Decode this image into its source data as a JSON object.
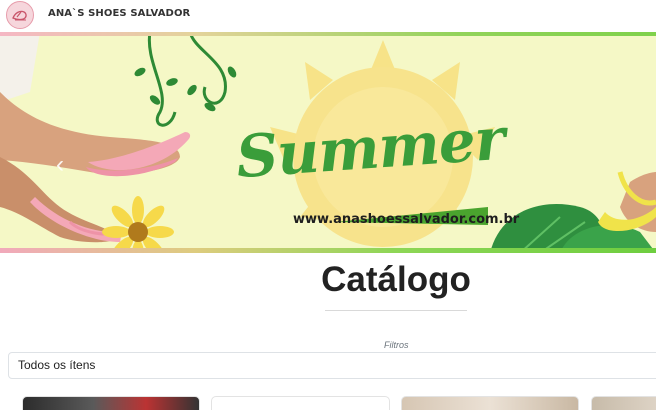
{
  "header": {
    "brand": "ANA`S SHOES SALVADOR",
    "logo_icon": "sandal-logo-icon"
  },
  "banner": {
    "headline": "Summer",
    "url": "www.anashoessalvador.com.br",
    "colors": {
      "background": "#f5f8c6",
      "headline": "#3a9d3a",
      "sun": "#f5d978",
      "sandal": "#f4a8b7"
    }
  },
  "catalog": {
    "title": "Catálogo",
    "filter_label": "Filtros",
    "filter_value": "Todos os ítens"
  }
}
